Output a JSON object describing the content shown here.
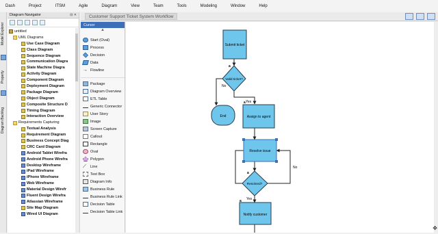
{
  "menu": [
    "Dash",
    "Project",
    "ITSM",
    "Agile",
    "Diagram",
    "View",
    "Team",
    "Tools",
    "Modeling",
    "Window",
    "Help"
  ],
  "side_tabs": [
    "Model Explorer",
    "Property",
    "Diagram Backlog"
  ],
  "navigator": {
    "title": "Diagram Navigator",
    "root": "untitled",
    "groups": [
      {
        "label": "UML Diagrams",
        "items": [
          "Use Case Diagram",
          "Class Diagram",
          "Sequence Diagram",
          "Communication Diagra",
          "State Machine Diagra",
          "Activity Diagram",
          "Component Diagram",
          "Deployment Diagram",
          "Package Diagram",
          "Object Diagram",
          "Composite Structure D",
          "Timing Diagram",
          "Interaction Overview"
        ]
      },
      {
        "label": "Requirements Capturing",
        "items": [
          "Textual Analysis",
          "Requirement Diagram",
          "Business Concept Diag",
          "CRC Card Diagram",
          "Android Tablet Wirefra",
          "Android Phone Wirefra",
          "Desktop Wireframe",
          "iPad Wireframe",
          "iPhone Wireframe",
          "Web Wireframe",
          "Material Design Wirefr",
          "Fluent Design Wirefra",
          "Atlassian Wireframe",
          "Site Map Diagram",
          "Wired UI Diagram"
        ]
      }
    ]
  },
  "palette": {
    "cursor": "Cursor",
    "items": [
      {
        "label": "Start (Oval)",
        "icon": "oval-icon"
      },
      {
        "label": "Process",
        "icon": "process-icon"
      },
      {
        "label": "Decision",
        "icon": "decision-icon"
      },
      {
        "label": "Data",
        "icon": "data-icon"
      },
      {
        "label": "Flowline",
        "icon": "flowline-icon"
      }
    ],
    "items2": [
      {
        "label": "Package",
        "icon": "package-icon"
      },
      {
        "label": "Diagram Overview",
        "icon": "overview-icon"
      },
      {
        "label": "ETL Table",
        "icon": "table-icon"
      },
      {
        "label": "Generic Connector",
        "icon": "connector-icon"
      },
      {
        "label": "User Story",
        "icon": "story-icon"
      },
      {
        "label": "Image",
        "icon": "image-icon"
      },
      {
        "label": "Screen Capture",
        "icon": "capture-icon"
      },
      {
        "label": "Callout",
        "icon": "callout-icon"
      },
      {
        "label": "Rectangle",
        "icon": "rectangle-icon"
      },
      {
        "label": "Oval",
        "icon": "oval-icon"
      },
      {
        "label": "Polygon",
        "icon": "polygon-icon"
      },
      {
        "label": "Line",
        "icon": "line-icon"
      },
      {
        "label": "Text Box",
        "icon": "textbox-icon"
      },
      {
        "label": "Diagram Info",
        "icon": "info-icon"
      },
      {
        "label": "Business Rule",
        "icon": "rule-icon"
      },
      {
        "label": "Business Rule Link",
        "icon": "rulelink-icon"
      },
      {
        "label": "Decision Table",
        "icon": "dtable-icon"
      },
      {
        "label": "Decision Table Link",
        "icon": "dtlink-icon"
      }
    ]
  },
  "diagram": {
    "title": "Customer Support Ticket System Workflow",
    "nodes": {
      "submit": "Submit ticket",
      "valid": "Valid ticket?",
      "end": "End",
      "assign": "Assign to agent",
      "resolve": "Resolve issue",
      "resolved": "Resolved?",
      "notify": "Notify customer"
    },
    "edge_labels": {
      "no1": "No",
      "yes1": "Yes",
      "no2": "No",
      "yes2": "Yes"
    },
    "colors": {
      "fill": "#6ec6ec",
      "stroke": "#2a3a4a",
      "selection": "#3d6fb8"
    }
  }
}
